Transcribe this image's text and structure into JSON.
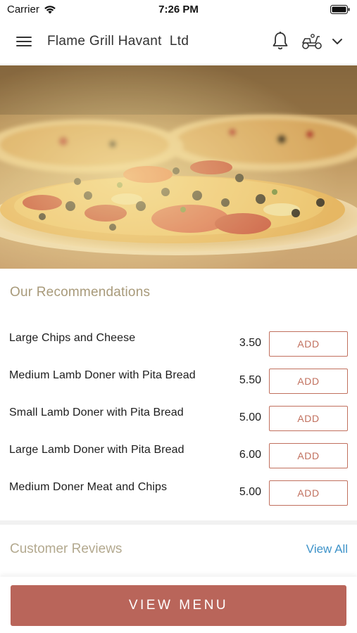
{
  "status_bar": {
    "carrier": "Carrier",
    "time": "7:26 PM"
  },
  "header": {
    "title": "Flame Grill Havant  Ltd",
    "icons": [
      "menu-icon",
      "bell-icon",
      "delivery-scooter-icon",
      "chevron-down-icon"
    ]
  },
  "hero": {
    "image": "pizza-image"
  },
  "recommendations": {
    "title": "Our Recommendations",
    "items": [
      {
        "name": "Large Chips and Cheese",
        "price": "3.50",
        "button": "ADD"
      },
      {
        "name": "Medium Lamb Doner with Pita Bread",
        "price": "5.50",
        "button": "ADD"
      },
      {
        "name": "Small Lamb Doner with Pita Bread",
        "price": "5.00",
        "button": "ADD"
      },
      {
        "name": "Large Lamb Doner with Pita Bread",
        "price": "6.00",
        "button": "ADD"
      },
      {
        "name": "Medium Doner Meat and Chips",
        "price": "5.00",
        "button": "ADD"
      }
    ]
  },
  "reviews": {
    "title": "Customer Reviews",
    "view_all": "View All"
  },
  "footer": {
    "view_menu": "VIEW MENU"
  },
  "colors": {
    "accent": "#b9655a",
    "add_button": "#c1705e",
    "section_title": "#a89a7a",
    "link": "#3e93c9"
  }
}
